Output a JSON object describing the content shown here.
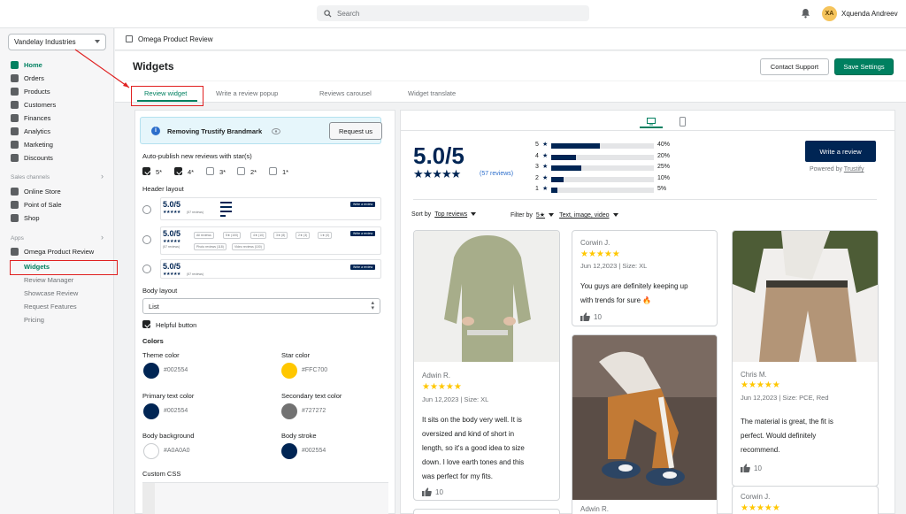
{
  "topbar": {
    "search_placeholder": "Search",
    "user_initials": "XA",
    "user_name": "Xquenda Andreev"
  },
  "sidebar": {
    "store": "Vandelay Industries",
    "items": [
      {
        "label": "Home",
        "icon": "home-icon"
      },
      {
        "label": "Orders",
        "icon": "orders-icon"
      },
      {
        "label": "Products",
        "icon": "products-icon"
      },
      {
        "label": "Customers",
        "icon": "customers-icon"
      },
      {
        "label": "Finances",
        "icon": "finances-icon"
      },
      {
        "label": "Analytics",
        "icon": "analytics-icon"
      },
      {
        "label": "Marketing",
        "icon": "marketing-icon"
      },
      {
        "label": "Discounts",
        "icon": "discounts-icon"
      }
    ],
    "sales_channels_label": "Sales channels",
    "channels": [
      {
        "label": "Online Store",
        "icon": "store-icon"
      },
      {
        "label": "Point of Sale",
        "icon": "pos-icon"
      },
      {
        "label": "Shop",
        "icon": "shop-icon"
      }
    ],
    "apps_label": "Apps",
    "app_name": "Omega Product Review",
    "app_subitems": [
      "Widgets",
      "Review Manager",
      "Showcase Review",
      "Request Features",
      "Pricing"
    ]
  },
  "app_header": {
    "title": "Omega Product Review"
  },
  "page": {
    "title": "Widgets",
    "contact_label": "Contact Support",
    "save_label": "Save Settings"
  },
  "tabs": [
    "Review widget",
    "Write a review popup",
    "Reviews carousel",
    "Widget translate"
  ],
  "settings": {
    "banner_text": "Removing Trustify Brandmark",
    "banner_button": "Request us",
    "auto_publish_label": "Auto-publish new reviews with star(s)",
    "star_options": [
      {
        "label": "5*",
        "checked": true
      },
      {
        "label": "4*",
        "checked": true
      },
      {
        "label": "3*",
        "checked": false
      },
      {
        "label": "2*",
        "checked": false
      },
      {
        "label": "1*",
        "checked": false
      }
    ],
    "header_layout_label": "Header layout",
    "mini": {
      "score": "5.0/5",
      "stars": "★★★★★",
      "count": "(57 reviews)",
      "write": "Write a review",
      "filter_chips": [
        "All reviews",
        "5★ (100)",
        "4★ (10)",
        "3★ (8)",
        "2★ (3)",
        "1★ (0)"
      ],
      "media_chips": [
        "Photo reviews (118)",
        "Video reviews (100)"
      ]
    },
    "body_layout_label": "Body layout",
    "body_layout_value": "List",
    "helpful_label": "Helpful button",
    "colors_label": "Colors",
    "colors": [
      {
        "label": "Theme color",
        "value": "#002554"
      },
      {
        "label": "Star color",
        "value": "#FFC700"
      },
      {
        "label": "Primary text color",
        "value": "#002554"
      },
      {
        "label": "Secondary text color",
        "value": "#727272"
      },
      {
        "label": "Body background",
        "value": "#A0A0A0",
        "swatch": "#ffffff"
      },
      {
        "label": "Body stroke",
        "value": "#002554"
      }
    ],
    "custom_css_label": "Custom CSS"
  },
  "preview": {
    "score": "5.0/5",
    "stars": "★★★★★",
    "count": "(57 reviews)",
    "histogram": [
      {
        "star": "5",
        "percent": "40%",
        "value": 40
      },
      {
        "star": "4",
        "percent": "20%",
        "value": 20
      },
      {
        "star": "3",
        "percent": "25%",
        "value": 25
      },
      {
        "star": "2",
        "percent": "10%",
        "value": 10
      },
      {
        "star": "1",
        "percent": "5%",
        "value": 5
      }
    ],
    "write_button": "Write a review",
    "powered_prefix": "Powered by ",
    "powered_brand": "Trustify",
    "sort_label": "Sort by",
    "sort_value": "Top reviews",
    "filter_label": "Filter by",
    "filter_stars": "5★",
    "filter_value": "Text, image, video",
    "reviews": [
      {
        "name": "Adwin R.",
        "stars": "★★★★★",
        "date": "Jun 12,2023",
        "size": "Size: XL",
        "text": [
          "It sits on the body very well. It is",
          "oversized and kind of short in",
          "length, so it's a good idea to size",
          "down. I love earth tones and this",
          "was perfect for my fits."
        ],
        "helpful": "10"
      },
      {
        "name": "Corwin J.",
        "stars": "★★★★★",
        "date": "Jun 12,2023",
        "size": "Size: XL",
        "text": [
          "You guys are definitely keeping up",
          "with trends for sure 🔥"
        ],
        "helpful": "10"
      },
      {
        "name": "Adwin R."
      },
      {
        "name": "Chris M.",
        "stars": "★★★★★",
        "date": "Jun 12,2023",
        "size": "Size: PCE, Red",
        "text": [
          "The material is great, the fit is",
          "perfect. Would definitely",
          "recommend."
        ],
        "helpful": "10"
      },
      {
        "name": "Corwin J.",
        "stars": "★★★★★"
      }
    ]
  }
}
